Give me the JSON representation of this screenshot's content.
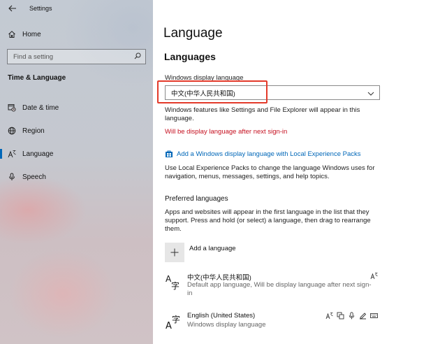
{
  "app": {
    "title": "Settings"
  },
  "sidebar": {
    "home_label": "Home",
    "search_placeholder": "Find a setting",
    "section_title": "Time & Language",
    "items": [
      {
        "label": "Date & time",
        "icon": "calendar-clock-icon"
      },
      {
        "label": "Region",
        "icon": "globe-icon"
      },
      {
        "label": "Language",
        "icon": "language-icon",
        "active": true
      },
      {
        "label": "Speech",
        "icon": "microphone-icon"
      }
    ]
  },
  "main": {
    "title": "Language",
    "languages_heading": "Languages",
    "display_language_label": "Windows display language",
    "display_language_value": "中文(中华人民共和国)",
    "features_note_line1": "Windows features like Settings and File Explorer will appear in this",
    "features_note_line2": "language.",
    "restart_note": "Will be display language after next sign-in",
    "lxp_link": "Add a Windows display language with Local Experience Packs",
    "lxp_desc_line1": "Use Local Experience Packs to change the language Windows uses for",
    "lxp_desc_line2": "navigation, menus, messages, settings, and help topics.",
    "preferred_heading": "Preferred languages",
    "preferred_desc_line1": "Apps and websites will appear in the first language in the list that they",
    "preferred_desc_line2": "support. Press and hold (or select) a language, then drag to rearrange",
    "preferred_desc_line3": "them.",
    "add_language_label": "Add a language",
    "languages": [
      {
        "name": "中文(中华人民共和国)",
        "sub": "Default app language, Will be display language after next sign-in",
        "glyph_top": "A",
        "glyph_char": "字"
      },
      {
        "name": "English (United States)",
        "sub": "Windows display language",
        "glyph_top": "A",
        "glyph_char": "字"
      }
    ]
  },
  "colors": {
    "accent": "#0067b8",
    "highlight": "#e33a2a",
    "warning": "#c50f1f"
  }
}
